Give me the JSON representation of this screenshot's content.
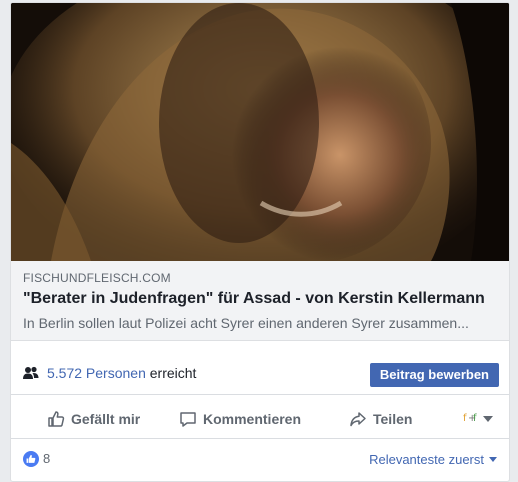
{
  "link_preview": {
    "domain": "FISCHUNDFLEISCH.COM",
    "title": "\"Berater in Judenfragen\" für Assad - von Kerstin Kellermann",
    "description": "In Berlin sollen laut Polizei acht Syrer einen anderen Syrer zusammen..."
  },
  "reach": {
    "count": "5.572 Personen",
    "suffix": "erreicht",
    "promote_label": "Beitrag bewerben"
  },
  "actions": {
    "like_label": "Gefällt mir",
    "comment_label": "Kommentieren",
    "share_label": "Teilen"
  },
  "footer": {
    "like_count": "8",
    "sort_label": "Relevanteste zuerst"
  },
  "colors": {
    "accent": "#4267b2",
    "like_badge": "#4a7bf2"
  },
  "icons": [
    "people-icon",
    "thumbs-up-icon",
    "comment-icon",
    "share-icon",
    "chevron-down-icon"
  ]
}
